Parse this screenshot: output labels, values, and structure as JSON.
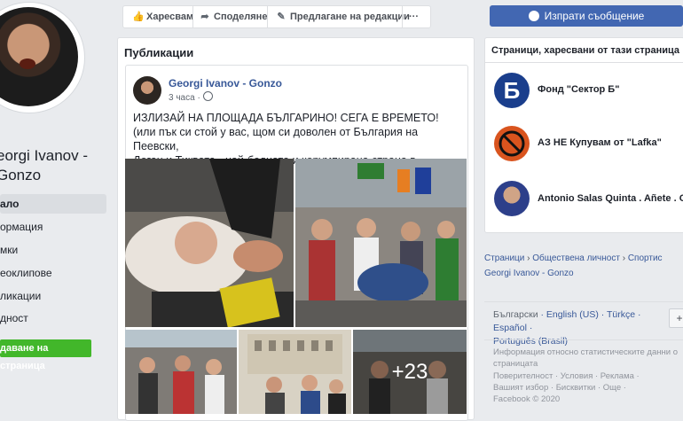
{
  "profile": {
    "name": "eorgi Ivanov - Gonzo",
    "nav": [
      "ало",
      "ормация",
      "мки",
      "еоклипове",
      "ликации",
      "дност"
    ],
    "create_page": "даване на страница"
  },
  "actions": {
    "like": "Харесвам",
    "share": "Споделяне",
    "suggest": "Предлагане на редакции",
    "more": "···"
  },
  "send_message": "Изпрати съобщение",
  "publications": {
    "title": "Публикации",
    "post": {
      "author": "Georgi Ivanov - Gonzo",
      "time": "3 часа ·",
      "text_line1": "ИЗЛИЗАЙ НА ПЛОЩАДА БЪЛГАРИНО! СЕГА Е ВРЕМЕТО!",
      "text_line2": "(или пък си стой у вас, щом си доволен от България на Пеевски,",
      "text_line3": "Доган и Тиквата - най-бедната и корумпирана страна в Европа!)",
      "more_photos": "+23"
    }
  },
  "liked_pages": {
    "title": "Страници, харесвани от тази страница",
    "items": [
      {
        "name": "Фонд \"Сектор Б\""
      },
      {
        "name": "АЗ НЕ Купувам от \"Lafka\""
      },
      {
        "name": "Antonio Salas Quinta . Añete . Of"
      }
    ]
  },
  "breadcrumbs": {
    "line1_a": "Страници",
    "line1_b": "Обществена личност",
    "line1_c": "Спортис",
    "line2": "Georgi Ivanov - Gonzo"
  },
  "languages": {
    "current": "Български",
    "l1": "English (US)",
    "l2": "Türkçe",
    "l3": "Español",
    "l4": "Português (Brasil)",
    "plus": "+"
  },
  "footer": {
    "line1": "Информация относно статистическите данни о",
    "line2": "страницата",
    "line3": "Поверителност · Условия · Реклама ·",
    "line4": "Вашият избор · Бисквитки · Още ·",
    "line5": "Facebook © 2020"
  }
}
